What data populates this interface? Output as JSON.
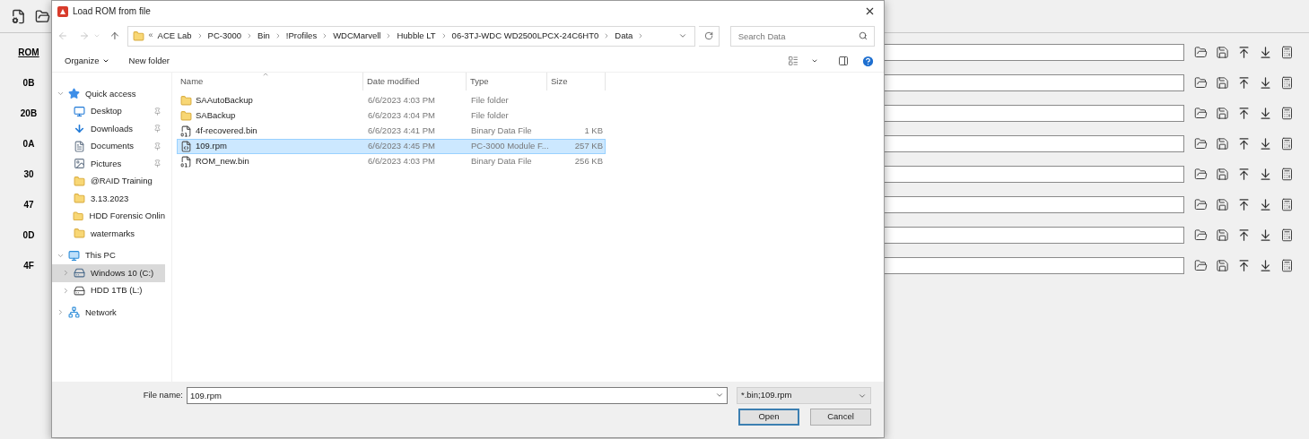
{
  "app": {
    "rows": [
      {
        "label": "ROM"
      },
      {
        "label": "0B"
      },
      {
        "label": "20B"
      },
      {
        "label": "0A"
      },
      {
        "label": "30"
      },
      {
        "label": "47"
      },
      {
        "label": "0D"
      },
      {
        "label": "4F"
      }
    ]
  },
  "dialog": {
    "title": "Load ROM from file",
    "path": {
      "overflow": "«",
      "crumbs": [
        "ACE Lab",
        "PC-3000",
        "Bin",
        "!Profiles",
        "WDCMarvell",
        "Hubble LT",
        "06-3TJ-WDC WD2500LPCX-24C6HT0",
        "Data"
      ]
    },
    "search": {
      "placeholder": "Search Data"
    },
    "toolbar": [
      "Organize",
      "New folder"
    ],
    "nav": [
      {
        "label": "Quick access",
        "kind": "star",
        "expanded": true,
        "selected": false,
        "children": [
          {
            "label": "Desktop",
            "kind": "desktop",
            "pinned": true,
            "selected": false
          },
          {
            "label": "Downloads",
            "kind": "download",
            "pinned": true,
            "selected": false
          },
          {
            "label": "Documents",
            "kind": "document",
            "pinned": true,
            "selected": false
          },
          {
            "label": "Pictures",
            "kind": "picture",
            "pinned": true,
            "selected": false
          },
          {
            "label": "@RAID Training",
            "kind": "folder",
            "pinned": false,
            "selected": false
          },
          {
            "label": "3.13.2023",
            "kind": "folder",
            "pinned": false,
            "selected": false
          },
          {
            "label": "HDD Forensic Onlin",
            "kind": "folder",
            "pinned": false,
            "selected": false
          },
          {
            "label": "watermarks",
            "kind": "folder",
            "pinned": false,
            "selected": false
          }
        ]
      },
      {
        "label": "This PC",
        "kind": "pc",
        "expanded": true,
        "selected": false,
        "children": [
          {
            "label": "Windows 10 (C:)",
            "kind": "system-drive",
            "expanded": false,
            "selected": true
          },
          {
            "label": "HDD 1TB (L:)",
            "kind": "drive",
            "expanded": false,
            "selected": false
          }
        ]
      },
      {
        "label": "Network",
        "kind": "network",
        "expanded": false,
        "selected": false
      }
    ],
    "columns": [
      "Name",
      "Date modified",
      "Type",
      "Size"
    ],
    "files": [
      {
        "name": "SAAutoBackup",
        "date": "6/6/2023 4:03 PM",
        "type": "File folder",
        "kind": "folder",
        "selected": false
      },
      {
        "name": "SABackup",
        "date": "6/6/2023 4:04 PM",
        "type": "File folder",
        "kind": "folder",
        "selected": false
      },
      {
        "name": "4f-recovered.bin",
        "date": "6/6/2023 4:41 PM",
        "type": "Binary Data File",
        "size": "1 KB",
        "kind": "binary",
        "selected": false
      },
      {
        "name": "109.rpm",
        "date": "6/6/2023 4:45 PM",
        "type": "PC-3000 Module F...",
        "size": "257 KB",
        "kind": "module",
        "selected": true
      },
      {
        "name": "ROM_new.bin",
        "date": "6/6/2023 4:03 PM",
        "type": "Binary Data File",
        "size": "256 KB",
        "kind": "binary",
        "selected": false
      }
    ],
    "file_name": {
      "label": "File name:",
      "value": "109.rpm"
    },
    "filter": "*.bin;109.rpm",
    "buttons": [
      {
        "label": "Open",
        "default": true
      },
      {
        "label": "Cancel",
        "default": false
      }
    ]
  }
}
